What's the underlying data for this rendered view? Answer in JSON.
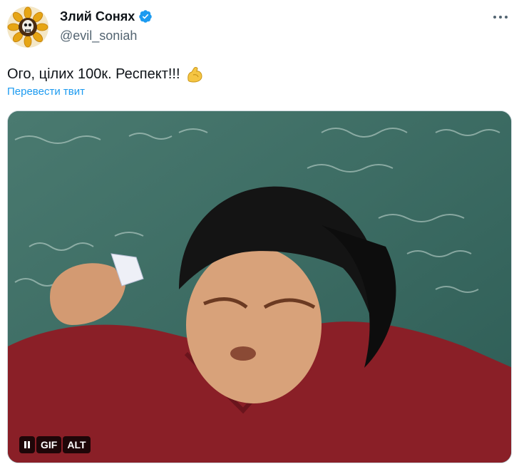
{
  "author": {
    "display_name": "Злий Сонях",
    "handle": "@evil_soniah",
    "avatar_icon": "sunflower-skull-avatar",
    "verified_icon": "verified-badge-icon",
    "verified_color": "#1d9bf0"
  },
  "tweet": {
    "text": "Ого, цілих 100к. Респект!!!",
    "emoji_icon": "flexed-biceps-icon",
    "translate_label": "Перевести твит"
  },
  "media": {
    "type": "gif",
    "controls": {
      "pause_icon": "pause-icon",
      "gif_label": "GIF",
      "alt_label": "ALT"
    }
  },
  "menu": {
    "more_icon": "more-dots-icon"
  }
}
